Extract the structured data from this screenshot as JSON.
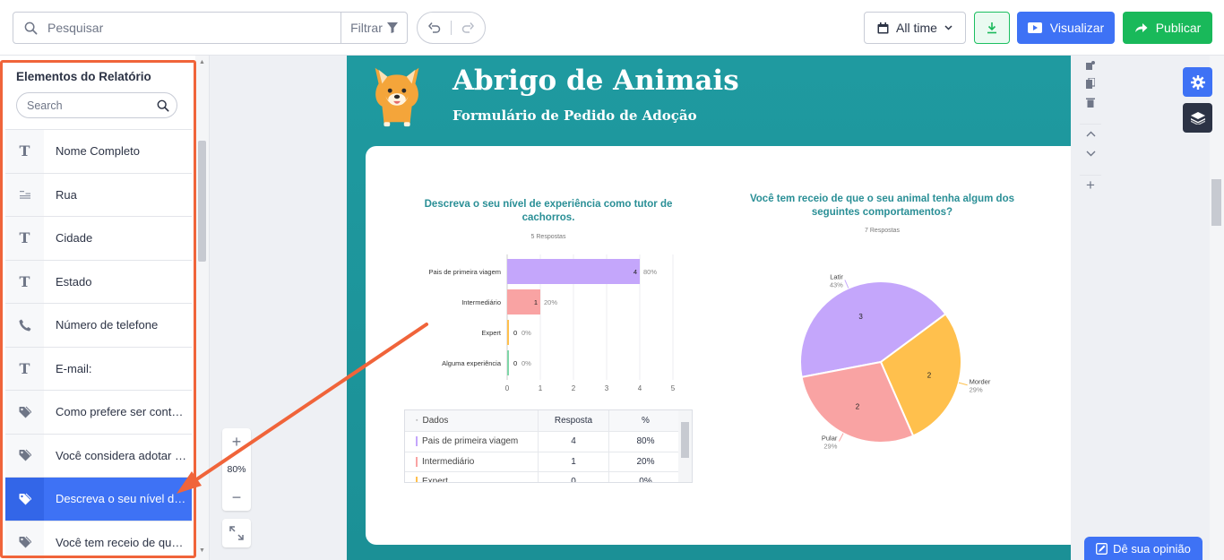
{
  "toolbar": {
    "search_placeholder": "Pesquisar",
    "filter_label": "Filtrar",
    "date_range_label": "All time",
    "preview_label": "Visualizar",
    "publish_label": "Publicar"
  },
  "left_panel": {
    "title": "Elementos do Relatório",
    "search_placeholder": "Search",
    "items": [
      {
        "icon": "text-icon",
        "label": "Nome Completo"
      },
      {
        "icon": "paragraph-icon",
        "label": "Rua"
      },
      {
        "icon": "text-icon",
        "label": "Cidade"
      },
      {
        "icon": "text-icon",
        "label": "Estado"
      },
      {
        "icon": "phone-icon",
        "label": "Número de telefone"
      },
      {
        "icon": "text-icon",
        "label": "E-mail:"
      },
      {
        "icon": "tag-icon",
        "label": "Como prefere ser contatado?"
      },
      {
        "icon": "tag-icon",
        "label": "Você considera adotar mais de um animal?"
      },
      {
        "icon": "tag-icon",
        "label": "Descreva o seu nível de experiência como tutor de cachorros."
      },
      {
        "icon": "tag-icon",
        "label": "Você tem receio de que o seu animal tenha algum dos seguintes comportamentos?"
      }
    ],
    "active_index": 8
  },
  "zoom": {
    "level": "80%"
  },
  "report": {
    "title": "Abrigo de Animais",
    "subtitle": "Formulário de Pedido de Adoção"
  },
  "colors": {
    "purple": "#c4a6fb",
    "red": "#f9a3a3",
    "yellow": "#ffc04d",
    "green": "#7fd6a8",
    "accent_blue": "#3e72f5",
    "publish_green": "#19b95a",
    "highlight_orange": "#f0643a",
    "page_teal": "#1f9aa0"
  },
  "chart_data": [
    {
      "type": "bar",
      "orientation": "horizontal",
      "title": "Descreva o seu nível de experiência como tutor de cachorros.",
      "subtitle": "5 Respostas",
      "categories": [
        "Pais de primeira viagem",
        "Intermediário",
        "Expert",
        "Alguma experiência"
      ],
      "values": [
        4,
        1,
        0,
        0
      ],
      "percents": [
        "80%",
        "20%",
        "0%",
        "0%"
      ],
      "xlim": [
        0,
        5
      ],
      "xticks": [
        "0",
        "1",
        "2",
        "3",
        "4",
        "5"
      ],
      "grid": true
    },
    {
      "type": "pie",
      "title": "Você tem receio de que o seu animal tenha algum dos seguintes comportamentos?",
      "subtitle": "7 Respostas",
      "categories": [
        "Latir",
        "Morder",
        "Pular"
      ],
      "values": [
        3,
        2,
        2
      ],
      "percents": [
        "43%",
        "29%",
        "29%"
      ]
    }
  ],
  "table": {
    "headers": [
      "Dados",
      "Resposta",
      "%"
    ],
    "rows": [
      {
        "label": "Pais de primeira viagem",
        "value": "4",
        "percent": "80%"
      },
      {
        "label": "Intermediário",
        "value": "1",
        "percent": "20%"
      },
      {
        "label": "Expert",
        "value": "0",
        "percent": "0%"
      }
    ]
  },
  "feedback": {
    "label": "Dê sua opinião"
  }
}
